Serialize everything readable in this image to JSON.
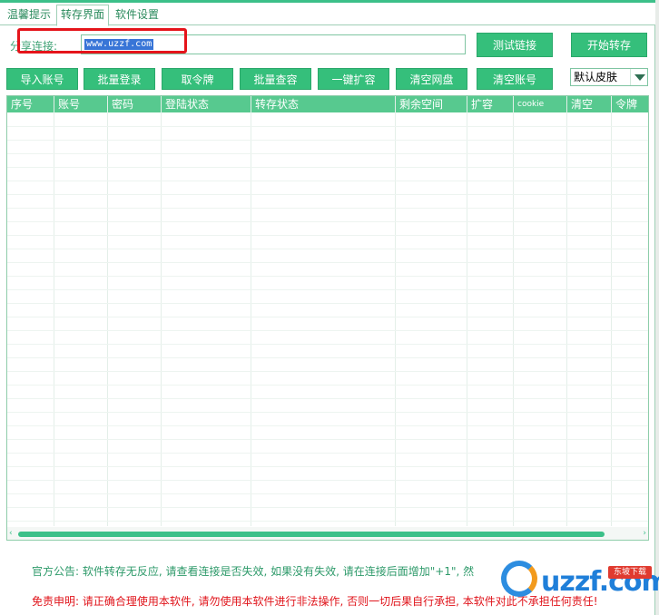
{
  "tabs": [
    {
      "label": "温馨提示"
    },
    {
      "label": "转存界面"
    },
    {
      "label": "软件设置"
    }
  ],
  "share": {
    "label": "分享连接:",
    "value": "www.uzzf.com"
  },
  "buttons": {
    "test_link": "测试链接",
    "start_transfer": "开始转存",
    "import_accounts": "导入账号",
    "batch_login": "批量登录",
    "get_token": "取令牌",
    "batch_check_capacity": "批量查容",
    "one_click_expand": "一键扩容",
    "clear_netdisk": "清空网盘",
    "clear_accounts": "清空账号"
  },
  "skin_select": {
    "value": "默认皮肤"
  },
  "table": {
    "columns": [
      "序号",
      "账号",
      "密码",
      "登陆状态",
      "转存状态",
      "剩余空间",
      "扩容",
      "cookie",
      "清空",
      "令牌"
    ]
  },
  "notice": "官方公告: 软件转存无反应, 请查看连接是否失效, 如果没有失效, 请在连接后面增加\"+1\", 然",
  "disclaimer": "免责申明: 请正确合理使用本软件, 请勿使用本软件进行非法操作, 否则一切后果自行承担, 本软件对此不承担任何责任!",
  "watermark": {
    "brand": "uzzf.com",
    "badge": "东坡下载"
  },
  "colors": {
    "accent": "#35bf7b",
    "header": "#57c98f",
    "warning": "#e0141b",
    "highlight_box": "#e5141b"
  }
}
